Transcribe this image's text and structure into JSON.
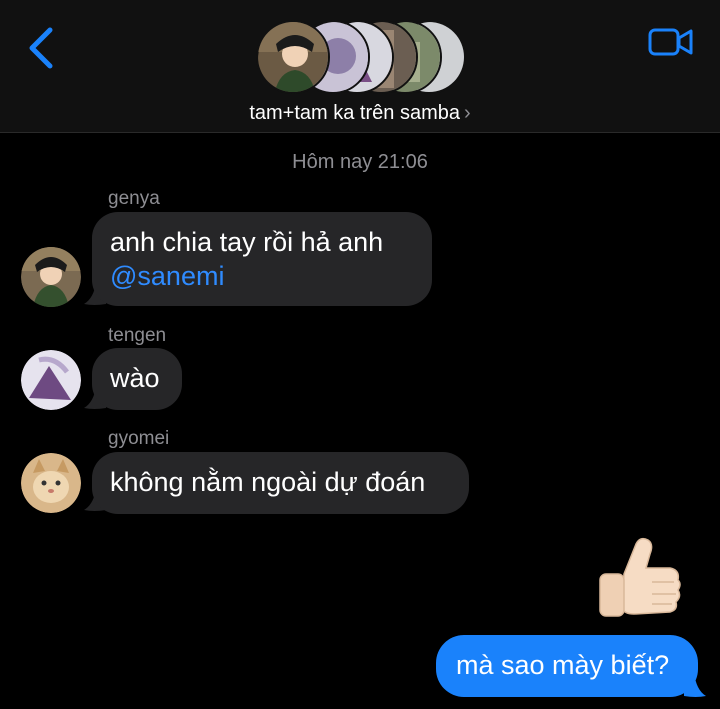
{
  "header": {
    "group_name": "tam+tam ka trên samba",
    "chevron": "›"
  },
  "timestamp": {
    "label": "Hôm nay",
    "time": "21:06"
  },
  "messages": [
    {
      "sender": "genya",
      "line1": "anh chia tay rồi hả anh",
      "mention": "@sanemi"
    },
    {
      "sender": "tengen",
      "text": "wào"
    },
    {
      "sender": "gyomei",
      "text": "không nằm ngoài dự đoán"
    }
  ],
  "outgoing": {
    "reaction": "thumbs-up-emoji",
    "text": "mà sao mày biết?"
  },
  "colors": {
    "accent": "#1a82fb",
    "incoming_bubble": "#262628",
    "secondary_text": "#8e8e93"
  }
}
